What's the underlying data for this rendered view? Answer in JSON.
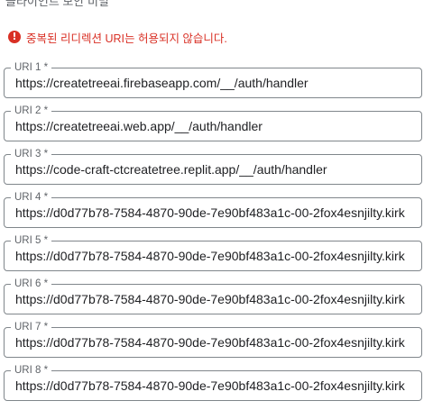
{
  "header": {
    "cut_text": "클라이언트 보안 비밀"
  },
  "error": {
    "icon": "error-icon",
    "message": "중복된 리디렉션 URI는 허용되지 않습니다."
  },
  "colors": {
    "error": "#d93025",
    "border": "#80868b",
    "label": "#5f6368"
  },
  "uris": [
    {
      "label": "URI 1 *",
      "value": "https://createtreeai.firebaseapp.com/__/auth/handler"
    },
    {
      "label": "URI 2 *",
      "value": "https://createtreeai.web.app/__/auth/handler"
    },
    {
      "label": "URI 3 *",
      "value": "https://code-craft-ctcreatetree.replit.app/__/auth/handler"
    },
    {
      "label": "URI 4 *",
      "value": "https://d0d77b78-7584-4870-90de-7e90bf483a1c-00-2fox4esnjilty.kirk"
    },
    {
      "label": "URI 5 *",
      "value": "https://d0d77b78-7584-4870-90de-7e90bf483a1c-00-2fox4esnjilty.kirk"
    },
    {
      "label": "URI 6 *",
      "value": "https://d0d77b78-7584-4870-90de-7e90bf483a1c-00-2fox4esnjilty.kirk"
    },
    {
      "label": "URI 7 *",
      "value": "https://d0d77b78-7584-4870-90de-7e90bf483a1c-00-2fox4esnjilty.kirk"
    },
    {
      "label": "URI 8 *",
      "value": "https://d0d77b78-7584-4870-90de-7e90bf483a1c-00-2fox4esnjilty.kirk"
    }
  ]
}
